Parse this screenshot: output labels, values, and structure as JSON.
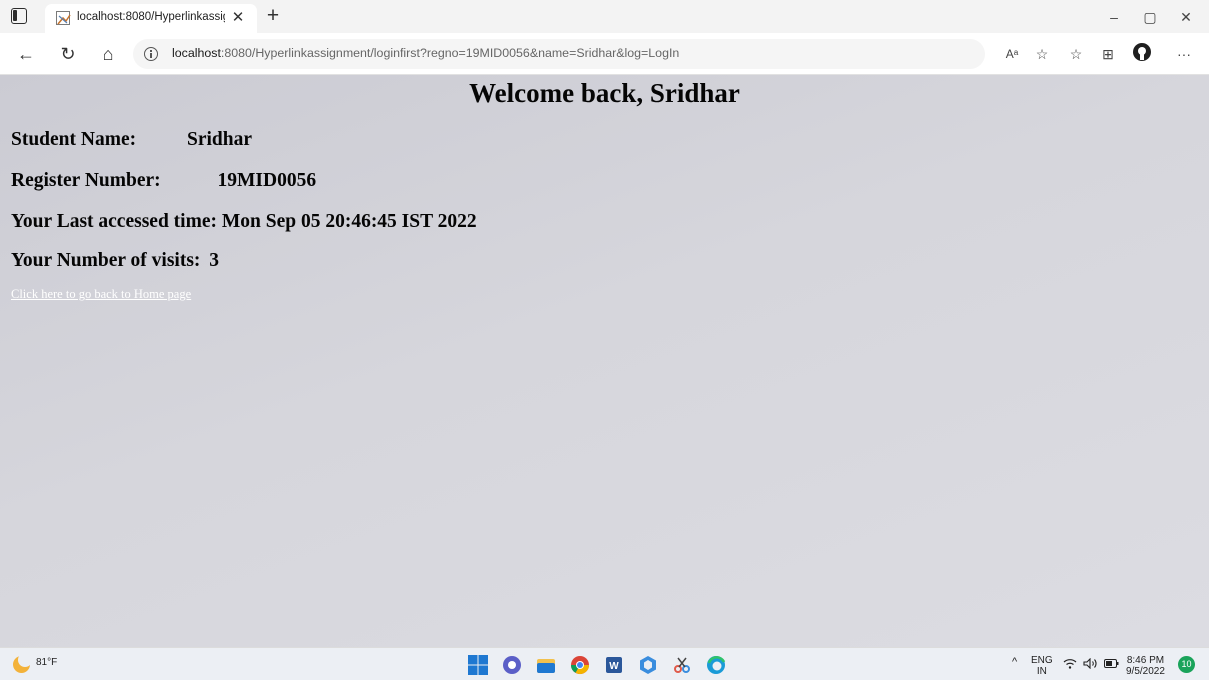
{
  "browser": {
    "tab_title": "localhost:8080/Hyperlinkassignm",
    "tab_close": "✕",
    "new_tab": "+",
    "url_host": "localhost",
    "url_rest": ":8080/Hyperlinkassignment/loginfirst?regno=19MID0056&name=Sridhar&log=LogIn",
    "read_aloud": "Aᵃ",
    "more": "···"
  },
  "page": {
    "heading": "Welcome back, Sridhar",
    "student_name_label": "Student Name:",
    "student_name_value": "Sridhar",
    "register_label": "Register Number:",
    "register_value": "19MID0056",
    "last_access": "Your Last accessed time: Mon Sep 05 20:46:45 IST 2022",
    "visits_label": "Your Number of visits:",
    "visits_value": "3",
    "home_link": "Click here to go back to Home page"
  },
  "taskbar": {
    "temperature": "81°F",
    "lang_top": "ENG",
    "lang_bottom": "IN",
    "time": "8:46 PM",
    "date": "9/5/2022",
    "notifications": "10"
  },
  "colors": {
    "start": "#1f78d1",
    "chat": "#5b5fc7",
    "files": "#f2c14e",
    "chrome": "#db4437",
    "word": "#2b579a",
    "edge": "#1a9bd7"
  }
}
